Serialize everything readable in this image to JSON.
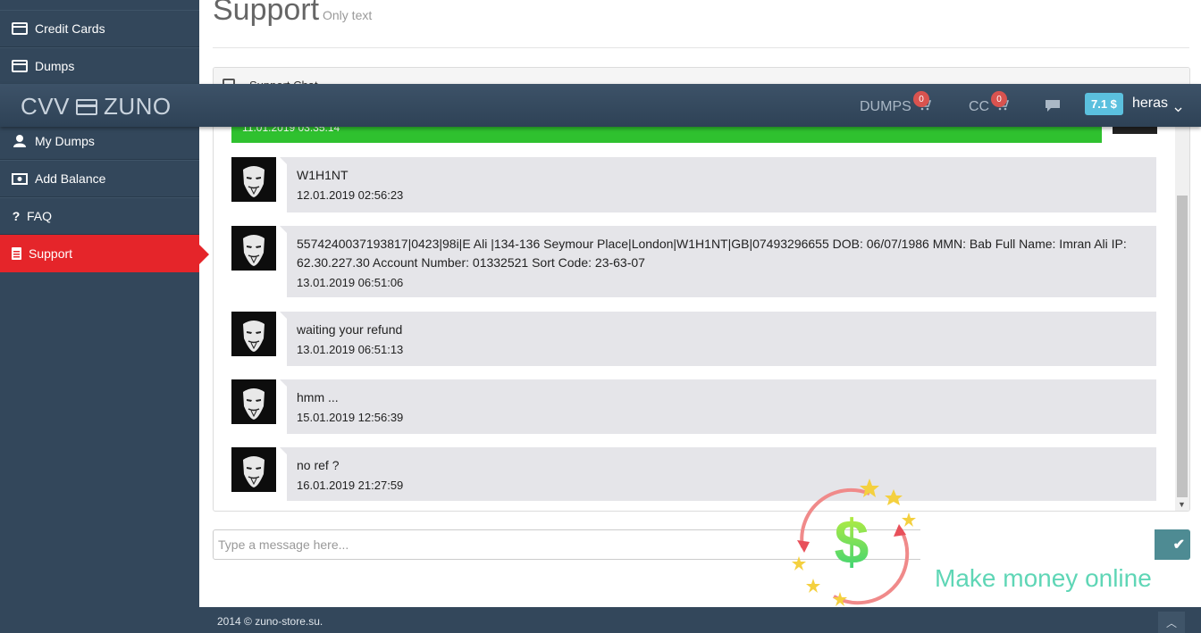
{
  "sidebar": {
    "items": [
      {
        "label": "Credit Cards",
        "icon": "credit-card-icon"
      },
      {
        "label": "Dumps",
        "icon": "credit-card-icon"
      },
      {
        "label": "My Dumps",
        "icon": "user-icon"
      },
      {
        "label": "Add Balance",
        "icon": "money-icon"
      },
      {
        "label": "FAQ",
        "icon": "question-icon"
      },
      {
        "label": "Support",
        "icon": "list-icon",
        "active": true
      }
    ]
  },
  "navbar": {
    "brand_left": "CVV",
    "brand_right": "ZUNO",
    "dumps_label": "DUMPS",
    "dumps_count": "0",
    "cc_label": "CC",
    "cc_count": "0",
    "balance": "7.1 $",
    "username": "heras"
  },
  "page": {
    "title": "Support",
    "subtitle": "Only text"
  },
  "chat": {
    "panel_title": "Support Chat",
    "first_message_time": "11.01.2019 03:35:14",
    "messages": [
      {
        "text": "W1H1NT",
        "time": "12.01.2019 02:56:23"
      },
      {
        "text": "5574240037193817|0423|98i|E Ali |134-136 Seymour Place|London|W1H1NT|GB|07493296655 DOB: 06/07/1986 MMN: Bab Full Name: Imran Ali IP: 62.30.227.30 Account Number: 01332521 Sort Code: 23-63-07",
        "time": "13.01.2019 06:51:06"
      },
      {
        "text": "waiting your refund",
        "time": "13.01.2019 06:51:13"
      },
      {
        "text": "hmm ...",
        "time": "15.01.2019 12:56:39"
      },
      {
        "text": "no ref ?",
        "time": "16.01.2019 21:27:59"
      }
    ],
    "input_placeholder": "Type a message here..."
  },
  "watermark": {
    "tagline": "Make money online"
  },
  "footer": {
    "copyright": "2014 © zuno-store.su."
  },
  "colors": {
    "sidebar_bg": "#33475b",
    "active_red": "#e5252a",
    "green_message": "#2fc12f",
    "balance_badge": "#5bc0de",
    "bubble_bg": "#e5e5e9"
  }
}
